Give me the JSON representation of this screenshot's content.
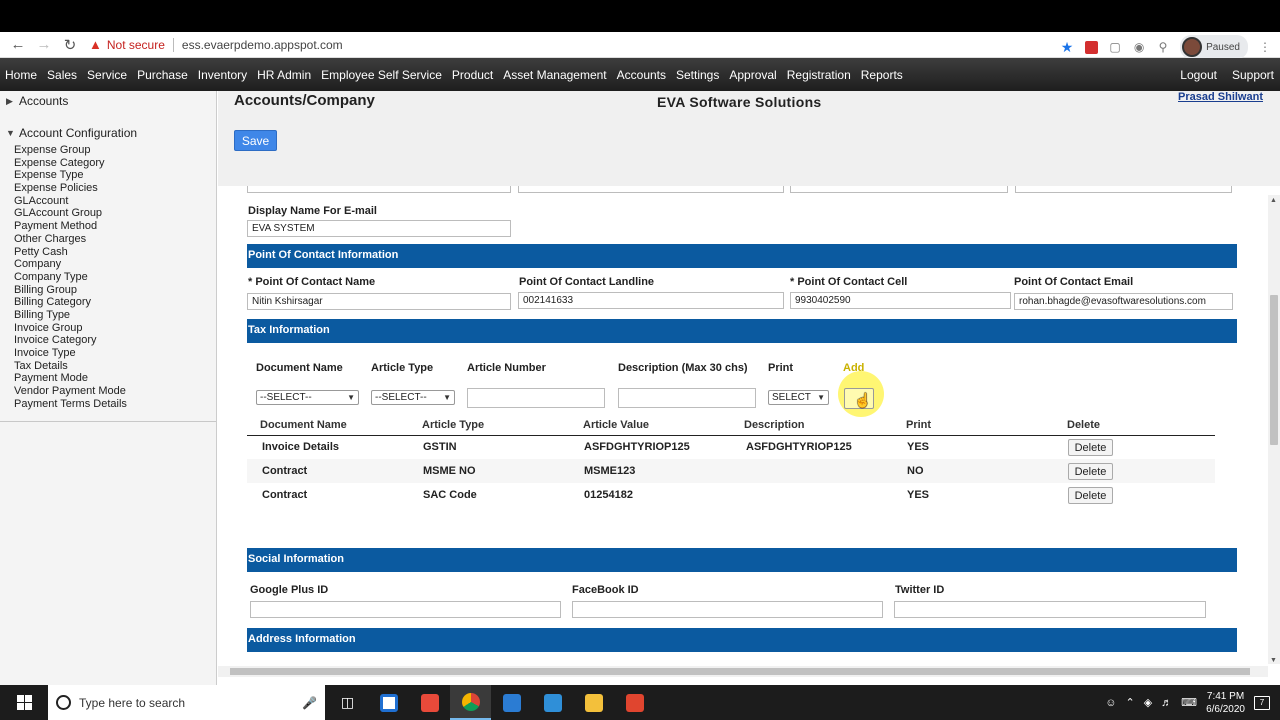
{
  "browser": {
    "security_label": "Not secure",
    "url": "ess.evaerpdemo.appspot.com",
    "profile_status": "Paused"
  },
  "menu": {
    "items": [
      "Home",
      "Sales",
      "Service",
      "Purchase",
      "Inventory",
      "HR Admin",
      "Employee Self Service",
      "Product",
      "Asset Management",
      "Accounts",
      "Settings",
      "Approval",
      "Registration",
      "Reports"
    ],
    "logout": "Logout",
    "support": "Support"
  },
  "sidebar": {
    "accounts": "Accounts",
    "account_config": "Account Configuration",
    "items": [
      "Expense Group",
      "Expense Category",
      "Expense Type",
      "Expense Policies",
      "GLAccount",
      "GLAccount Group",
      "Payment Method",
      "Other Charges",
      "Petty Cash",
      "Company",
      "Company Type",
      "Billing Group",
      "Billing Category",
      "Billing Type",
      "Invoice Group",
      "Invoice Category",
      "Invoice Type",
      "Tax Details",
      "Payment Mode",
      "Vendor Payment Mode",
      "Payment Terms Details"
    ]
  },
  "header": {
    "title": "Accounts/Company",
    "company": "EVA Software Solutions",
    "user": "Prasad Shilwant",
    "save": "Save"
  },
  "form": {
    "display_name_label": "Display Name For E-mail",
    "display_name_value": "EVA SYSTEM",
    "poc_section": "Point Of Contact Information",
    "poc_name_label": "Point Of Contact Name",
    "poc_name_value": "Nitin Kshirsagar",
    "poc_landline_label": "Point Of Contact Landline",
    "poc_landline_value": "002141633",
    "poc_cell_label": "Point Of Contact Cell",
    "poc_cell_value": "9930402590",
    "poc_email_label": "Point Of Contact Email",
    "poc_email_value": "rohan.bhagde@evasoftwaresolutions.com",
    "required_mark": "*"
  },
  "tax": {
    "section": "Tax Information",
    "doc_name_label": "Document Name",
    "article_type_label": "Article Type",
    "article_number_label": "Article Number",
    "description_label": "Description (Max 30 chs)",
    "print_label": "Print",
    "add_label": "Add",
    "doc_select": "--SELECT--",
    "article_select": "--SELECT--",
    "print_select": "SELECT",
    "add_button": "Add",
    "table_headers": [
      "Document Name",
      "Article Type",
      "Article Value",
      "Description",
      "Print",
      "Delete"
    ],
    "rows": [
      {
        "document": "Invoice Details",
        "article_type": "GSTIN",
        "article_value": "ASFDGHTYRIOP125",
        "description": "ASFDGHTYRIOP125",
        "print": "YES",
        "delete": "Delete"
      },
      {
        "document": "Contract",
        "article_type": "MSME NO",
        "article_value": "MSME123",
        "description": "",
        "print": "NO",
        "delete": "Delete"
      },
      {
        "document": "Contract",
        "article_type": "SAC Code",
        "article_value": "01254182",
        "description": "",
        "print": "YES",
        "delete": "Delete"
      }
    ]
  },
  "social": {
    "section": "Social Information",
    "google_label": "Google Plus ID",
    "facebook_label": "FaceBook ID",
    "twitter_label": "Twitter ID"
  },
  "address": {
    "section": "Address Information"
  },
  "taskbar": {
    "search_placeholder": "Type here to search",
    "time": "7:41 PM",
    "date": "6/6/2020",
    "notifications": "7"
  },
  "colors": {
    "section_header": "#0b5aa0",
    "save_button": "#3f87e8",
    "menubar": "#2b2b2b"
  }
}
